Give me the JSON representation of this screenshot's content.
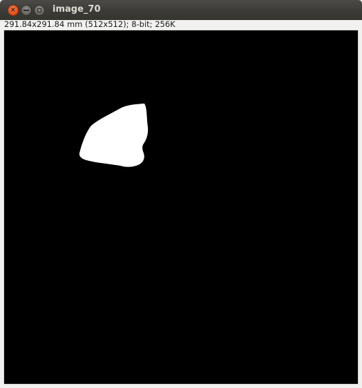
{
  "window": {
    "title": "image_70",
    "buttons": {
      "close": "close-icon",
      "minimize": "minimize-icon",
      "maximize": "maximize-icon"
    }
  },
  "info": {
    "text": "291.84x291.84 mm (512x512); 8-bit; 256K"
  },
  "image": {
    "background_color": "#000000",
    "foreground_color": "#ffffff",
    "content": "white-blob"
  }
}
